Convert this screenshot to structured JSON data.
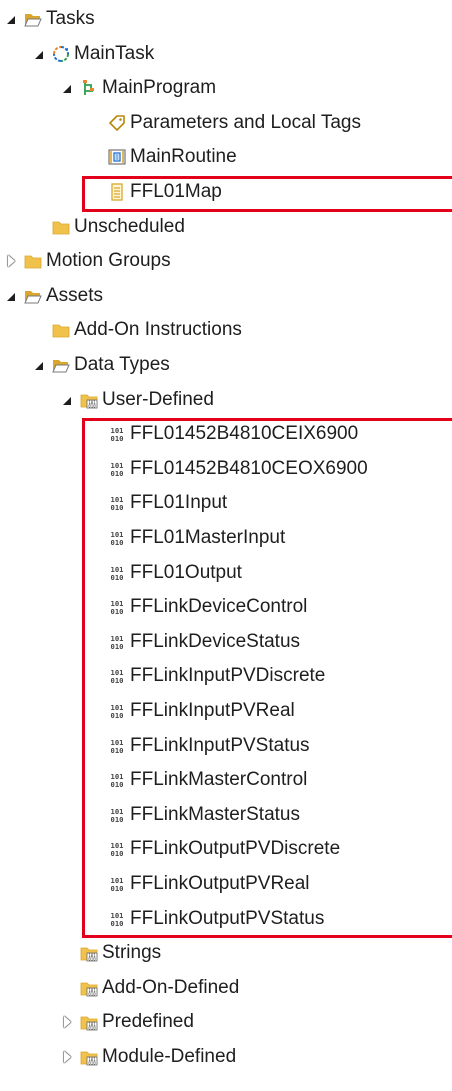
{
  "tree": {
    "rows": [
      {
        "label": "Tasks",
        "icon": "folder-open-icon",
        "expander": "expanded",
        "depth": 0
      },
      {
        "label": "MainTask",
        "icon": "task-cycle-icon",
        "expander": "expanded",
        "depth": 1
      },
      {
        "label": "MainProgram",
        "icon": "program-icon",
        "expander": "expanded",
        "depth": 2
      },
      {
        "label": "Parameters and Local Tags",
        "icon": "tag-icon",
        "expander": "none",
        "depth": 3
      },
      {
        "label": "MainRoutine",
        "icon": "routine-icon",
        "expander": "none",
        "depth": 3
      },
      {
        "label": "FFL01Map",
        "icon": "mapping-icon",
        "expander": "none",
        "depth": 3
      },
      {
        "label": "Unscheduled",
        "icon": "folder-icon",
        "expander": "none",
        "depth": 1
      },
      {
        "label": "Motion Groups",
        "icon": "folder-icon",
        "expander": "collapsed",
        "depth": 0
      },
      {
        "label": "Assets",
        "icon": "folder-open-icon",
        "expander": "expanded",
        "depth": 0
      },
      {
        "label": "Add-On Instructions",
        "icon": "folder-icon",
        "expander": "none",
        "depth": 1
      },
      {
        "label": "Data Types",
        "icon": "folder-open-icon",
        "expander": "expanded",
        "depth": 1
      },
      {
        "label": "User-Defined",
        "icon": "datatype-folder-icon",
        "expander": "expanded",
        "depth": 2
      },
      {
        "label": "FFL01452B4810CEIX6900",
        "icon": "binary-datatype-icon",
        "expander": "none",
        "depth": 3
      },
      {
        "label": "FFL01452B4810CEOX6900",
        "icon": "binary-datatype-icon",
        "expander": "none",
        "depth": 3
      },
      {
        "label": "FFL01Input",
        "icon": "binary-datatype-icon",
        "expander": "none",
        "depth": 3
      },
      {
        "label": "FFL01MasterInput",
        "icon": "binary-datatype-icon",
        "expander": "none",
        "depth": 3
      },
      {
        "label": "FFL01Output",
        "icon": "binary-datatype-icon",
        "expander": "none",
        "depth": 3
      },
      {
        "label": "FFLinkDeviceControl",
        "icon": "binary-datatype-icon",
        "expander": "none",
        "depth": 3
      },
      {
        "label": "FFLinkDeviceStatus",
        "icon": "binary-datatype-icon",
        "expander": "none",
        "depth": 3
      },
      {
        "label": "FFLinkInputPVDiscrete",
        "icon": "binary-datatype-icon",
        "expander": "none",
        "depth": 3
      },
      {
        "label": "FFLinkInputPVReal",
        "icon": "binary-datatype-icon",
        "expander": "none",
        "depth": 3
      },
      {
        "label": "FFLinkInputPVStatus",
        "icon": "binary-datatype-icon",
        "expander": "none",
        "depth": 3
      },
      {
        "label": "FFLinkMasterControl",
        "icon": "binary-datatype-icon",
        "expander": "none",
        "depth": 3
      },
      {
        "label": "FFLinkMasterStatus",
        "icon": "binary-datatype-icon",
        "expander": "none",
        "depth": 3
      },
      {
        "label": "FFLinkOutputPVDiscrete",
        "icon": "binary-datatype-icon",
        "expander": "none",
        "depth": 3
      },
      {
        "label": "FFLinkOutputPVReal",
        "icon": "binary-datatype-icon",
        "expander": "none",
        "depth": 3
      },
      {
        "label": "FFLinkOutputPVStatus",
        "icon": "binary-datatype-icon",
        "expander": "none",
        "depth": 3
      },
      {
        "label": "Strings",
        "icon": "datatype-folder-icon",
        "expander": "none",
        "depth": 2
      },
      {
        "label": "Add-On-Defined",
        "icon": "datatype-folder-icon",
        "expander": "none",
        "depth": 2
      },
      {
        "label": "Predefined",
        "icon": "datatype-folder-icon",
        "expander": "collapsed",
        "depth": 2
      },
      {
        "label": "Module-Defined",
        "icon": "datatype-folder-icon",
        "expander": "collapsed",
        "depth": 2
      }
    ],
    "highlights": [
      {
        "name": "highlight-ffl01map",
        "first_row": 5,
        "last_row": 5
      },
      {
        "name": "highlight-user-defined-types",
        "first_row": 12,
        "last_row": 26
      }
    ]
  },
  "colors": {
    "folder": "#f0c24b",
    "folder_dark": "#d9a62e",
    "highlight": "#e2001a",
    "task_blue": "#1f6fd1",
    "program_green": "#2e9e4f",
    "program_orange": "#e8872a",
    "text": "#1e1e1e"
  }
}
